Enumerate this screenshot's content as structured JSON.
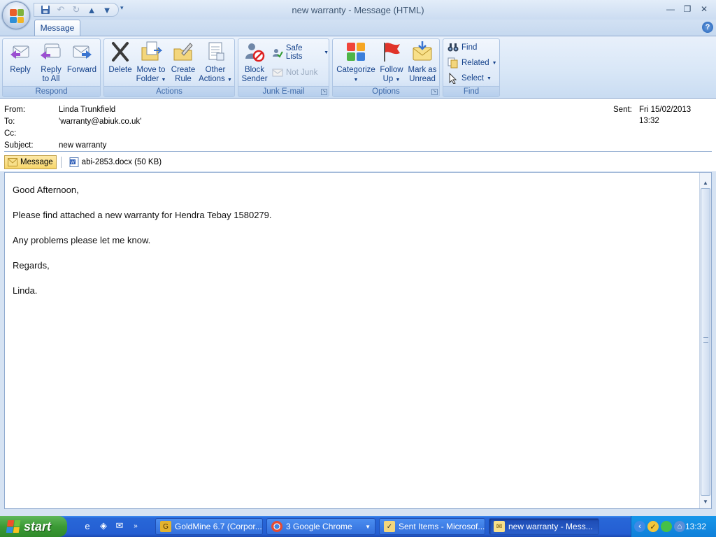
{
  "window": {
    "title": "new warranty - Message (HTML)"
  },
  "quick_access": {
    "icons": [
      "save-icon",
      "undo-icon",
      "redo-icon",
      "previous-item-icon",
      "next-item-icon",
      "customize-toolbar-icon"
    ]
  },
  "ribbon": {
    "tab": "Message",
    "groups": {
      "respond": {
        "label": "Respond",
        "reply": "Reply",
        "reply_all_1": "Reply",
        "reply_all_2": "to All",
        "forward": "Forward"
      },
      "actions": {
        "label": "Actions",
        "delete": "Delete",
        "move_1": "Move to",
        "move_2": "Folder",
        "create_1": "Create",
        "create_2": "Rule",
        "other_1": "Other",
        "other_2": "Actions"
      },
      "junk": {
        "label": "Junk E-mail",
        "block_1": "Block",
        "block_2": "Sender",
        "safe_lists": "Safe Lists",
        "not_junk": "Not Junk"
      },
      "options": {
        "label": "Options",
        "categorize": "Categorize",
        "follow_1": "Follow",
        "follow_2": "Up",
        "mark_1": "Mark as",
        "mark_2": "Unread"
      },
      "find": {
        "label": "Find",
        "find": "Find",
        "related": "Related",
        "select": "Select"
      }
    }
  },
  "header": {
    "from_label": "From:",
    "from": "Linda Trunkfield",
    "to_label": "To:",
    "to": "'warranty@abiuk.co.uk'",
    "cc_label": "Cc:",
    "cc": "",
    "subject_label": "Subject:",
    "subject": "new warranty",
    "sent_label": "Sent:",
    "sent": "Fri 15/02/2013 13:32"
  },
  "attachments": {
    "message_tab": "Message",
    "file": "abi-2853.docx (50 KB)"
  },
  "body": {
    "greeting": "Good Afternoon,",
    "line1": "Please find attached a new warranty for Hendra Tebay 1580279.",
    "line2": "Any problems please let me know.",
    "closing": "Regards,",
    "signature": "Linda."
  },
  "taskbar": {
    "start": "start",
    "tasks": [
      {
        "label": "GoldMine 6.7 (Corpor..."
      },
      {
        "label": "3 Google Chrome"
      },
      {
        "label": "Sent Items - Microsof..."
      },
      {
        "label": "new warranty - Mess..."
      }
    ],
    "clock": "13:32"
  }
}
